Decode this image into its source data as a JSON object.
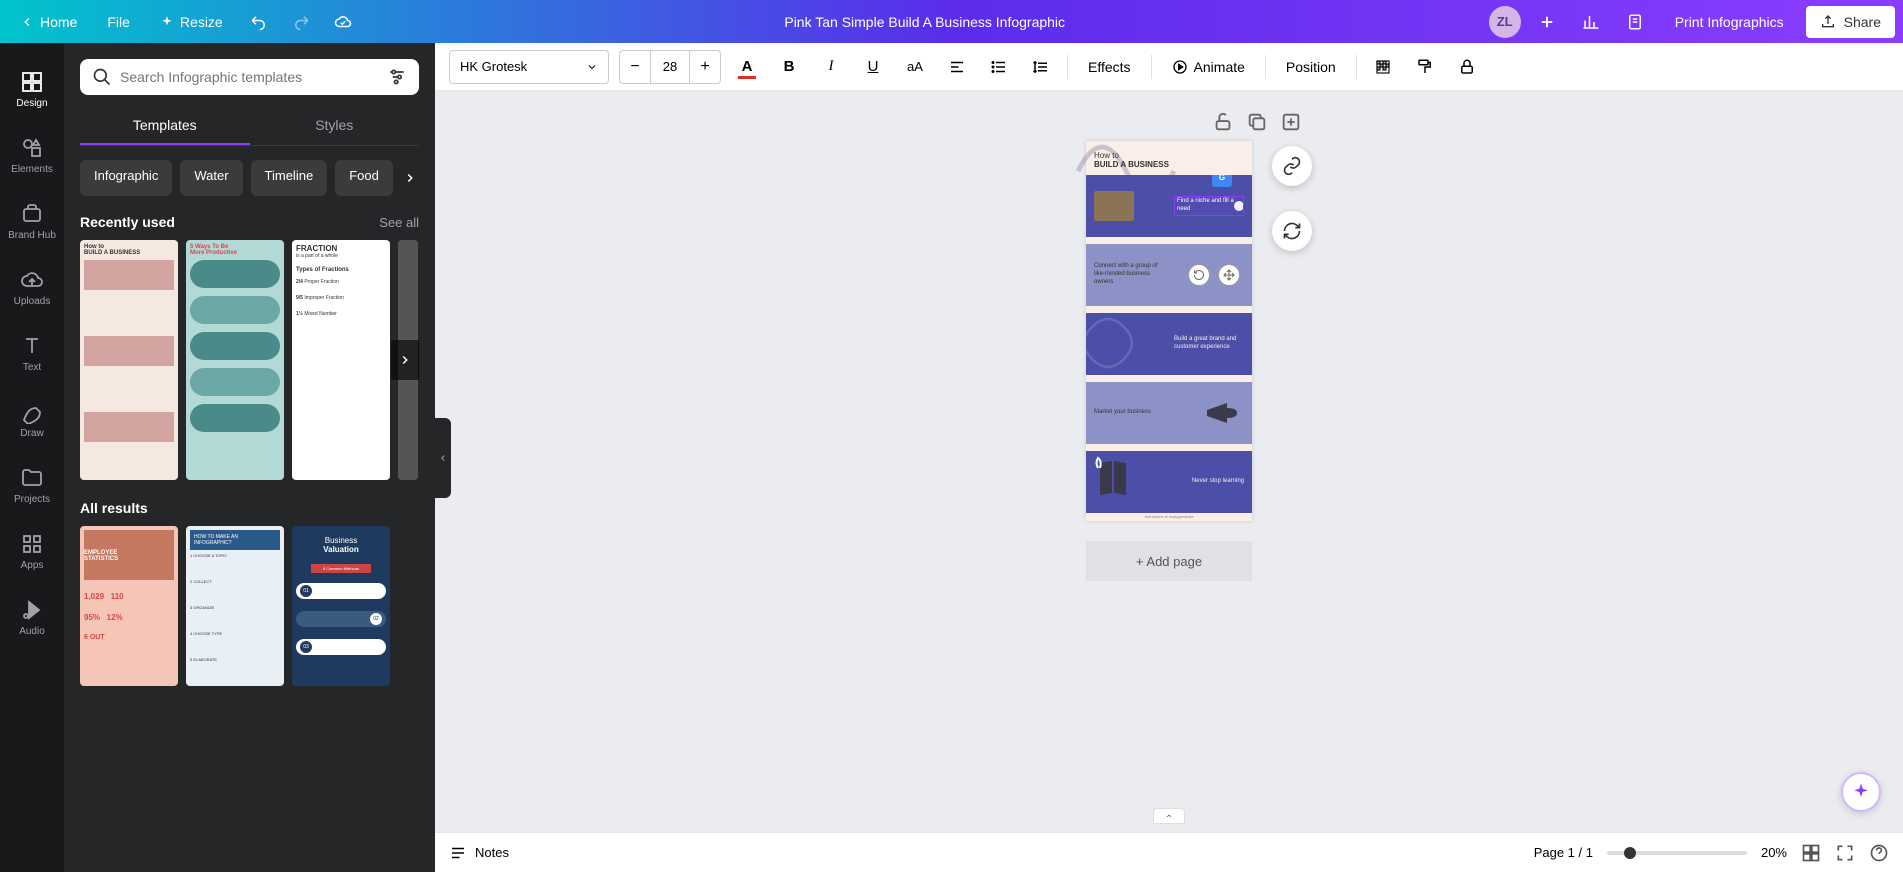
{
  "header": {
    "home": "Home",
    "file": "File",
    "resize": "Resize",
    "title": "Pink Tan Simple Build A Business Infographic",
    "avatar": "ZL",
    "print": "Print Infographics",
    "share": "Share"
  },
  "rail": {
    "items": [
      {
        "label": "Design"
      },
      {
        "label": "Elements"
      },
      {
        "label": "Brand Hub"
      },
      {
        "label": "Uploads"
      },
      {
        "label": "Text"
      },
      {
        "label": "Draw"
      },
      {
        "label": "Projects"
      },
      {
        "label": "Apps"
      },
      {
        "label": "Audio"
      }
    ]
  },
  "panel": {
    "search_placeholder": "Search Infographic templates",
    "tabs": [
      "Templates",
      "Styles"
    ],
    "chips": [
      "Infographic",
      "Water",
      "Timeline",
      "Food"
    ],
    "recent_title": "Recently used",
    "see_all": "See all",
    "all_results": "All results"
  },
  "toolbar": {
    "font": "HK Grotesk",
    "size": "28",
    "effects": "Effects",
    "animate": "Animate",
    "position": "Position"
  },
  "canvas": {
    "page_title1": "How to",
    "page_title2": "BUILD A BUSINESS",
    "sections": [
      "Find a niche and fill a need",
      "Connect with a group of like-minded business owners",
      "Build a great brand and customer experience",
      "Market your business",
      "Never stop learning"
    ],
    "add_page": "+ Add page"
  },
  "bottom": {
    "notes": "Notes",
    "page_info": "Page 1 / 1",
    "zoom": "20%"
  }
}
